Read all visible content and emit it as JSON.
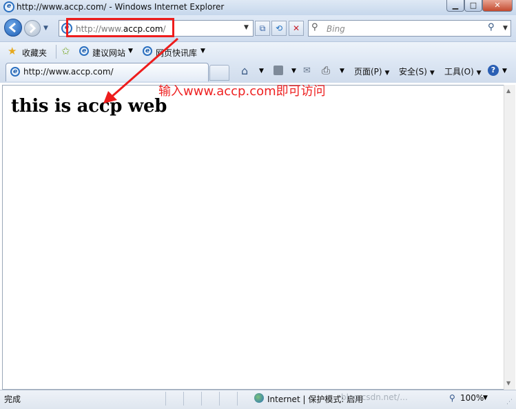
{
  "window": {
    "title": "http://www.accp.com/ - Windows Internet Explorer",
    "min_glyph": "▁",
    "max_glyph": "□",
    "close_glyph": "✕"
  },
  "navigation": {
    "address": {
      "prefix": "http://www.",
      "host": "accp.com",
      "suffix": "/"
    },
    "search_placeholder": "Bing",
    "dropdown_glyph": "▼"
  },
  "favorites_bar": {
    "label": "收藏夹",
    "items": [
      {
        "label": "建议网站",
        "icon": "ie-page-icon"
      },
      {
        "label": "网页快讯库",
        "icon": "ie-page-icon"
      }
    ]
  },
  "tab": {
    "label": "http://www.accp.com/"
  },
  "command_bar": {
    "page": "页面(P)",
    "safety": "安全(S)",
    "tools": "工具(O)"
  },
  "content": {
    "heading": "this is accp web"
  },
  "annotation": {
    "text": "输入www.accp.com即可访问",
    "color": "#ee1c1c"
  },
  "status_bar": {
    "status": "完成",
    "zone": "Internet | 保护模式: 启用",
    "watermark": "blog.csdn.net/...",
    "zoom": "100%"
  }
}
